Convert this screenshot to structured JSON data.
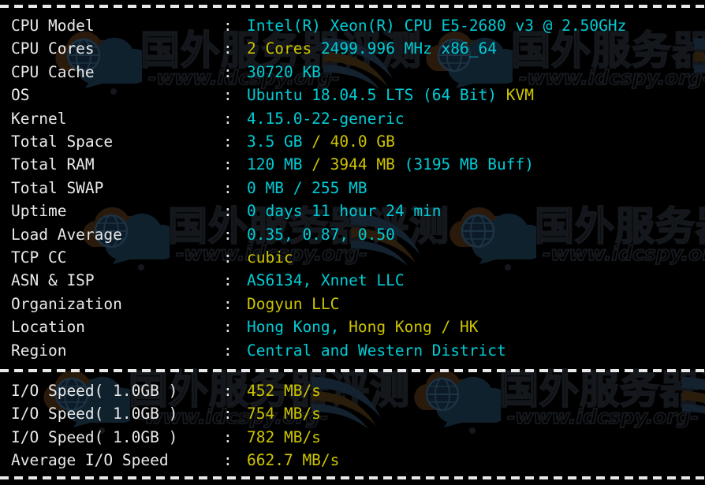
{
  "terminal": {
    "colon": ":",
    "colors": {
      "background": "#000000",
      "label": "#e9e9e9",
      "cyan": "#00ccd6",
      "yellow": "#cdc400",
      "separator": "#e8e8e8"
    }
  },
  "watermark": {
    "chinese_text": "国外服务器评测",
    "url_text": "-www.idcspy.org-",
    "logo_name": "cloud-globe-speech-logo"
  },
  "separators": [
    "top-dashed-rule",
    "middle-dashed-rule",
    "bottom-dashed-rule"
  ],
  "system_info": {
    "rows": [
      {
        "label": "CPU Model",
        "segments": [
          {
            "t": "Intel(R) Xeon(R) CPU E5-2680 v3 @ 2.50GHz",
            "c": "c"
          }
        ]
      },
      {
        "label": "CPU Cores",
        "segments": [
          {
            "t": "2 Cores",
            "c": "y"
          },
          {
            "t": " 2499.996 MHz x86_64",
            "c": "c"
          }
        ]
      },
      {
        "label": "CPU Cache",
        "segments": [
          {
            "t": "30720 KB",
            "c": "c"
          }
        ]
      },
      {
        "label": "OS",
        "segments": [
          {
            "t": "Ubuntu 18.04.5 LTS (64 Bit) ",
            "c": "c"
          },
          {
            "t": "KVM",
            "c": "y"
          }
        ]
      },
      {
        "label": "Kernel",
        "segments": [
          {
            "t": "4.15.0-22-generic",
            "c": "c"
          }
        ]
      },
      {
        "label": "Total Space",
        "segments": [
          {
            "t": "3.5 GB ",
            "c": "c"
          },
          {
            "t": "/ ",
            "c": "y"
          },
          {
            "t": "40.0 GB",
            "c": "y"
          }
        ]
      },
      {
        "label": "Total RAM",
        "segments": [
          {
            "t": "120 MB ",
            "c": "c"
          },
          {
            "t": "/ 3944 MB ",
            "c": "y"
          },
          {
            "t": "(3195 MB Buff)",
            "c": "c"
          }
        ]
      },
      {
        "label": "Total SWAP",
        "segments": [
          {
            "t": "0 MB / 255 MB",
            "c": "c"
          }
        ]
      },
      {
        "label": "Uptime",
        "segments": [
          {
            "t": "0 days 11 hour 24 min",
            "c": "c"
          }
        ]
      },
      {
        "label": "Load Average",
        "segments": [
          {
            "t": "0.35, 0.87, 0.50",
            "c": "c"
          }
        ]
      },
      {
        "label": "TCP CC",
        "segments": [
          {
            "t": "cubic",
            "c": "y"
          }
        ]
      },
      {
        "label": "ASN & ISP",
        "segments": [
          {
            "t": "AS6134, Xnnet LLC",
            "c": "c"
          }
        ]
      },
      {
        "label": "Organization",
        "segments": [
          {
            "t": "Dogyun LLC",
            "c": "y"
          }
        ]
      },
      {
        "label": "Location",
        "segments": [
          {
            "t": "Hong Kong, ",
            "c": "c"
          },
          {
            "t": "Hong Kong / HK",
            "c": "y"
          }
        ]
      },
      {
        "label": "Region",
        "segments": [
          {
            "t": "Central and Western District",
            "c": "c"
          }
        ]
      }
    ]
  },
  "io_benchmark": {
    "rows": [
      {
        "label": "I/O Speed( 1.0GB )",
        "segments": [
          {
            "t": "452 MB/s",
            "c": "y"
          }
        ]
      },
      {
        "label": "I/O Speed( 1.0GB )",
        "segments": [
          {
            "t": "754 MB/s",
            "c": "y"
          }
        ]
      },
      {
        "label": "I/O Speed( 1.0GB )",
        "segments": [
          {
            "t": "782 MB/s",
            "c": "y"
          }
        ]
      },
      {
        "label": "Average I/O Speed",
        "segments": [
          {
            "t": "662.7 MB/s",
            "c": "y"
          }
        ]
      }
    ]
  }
}
